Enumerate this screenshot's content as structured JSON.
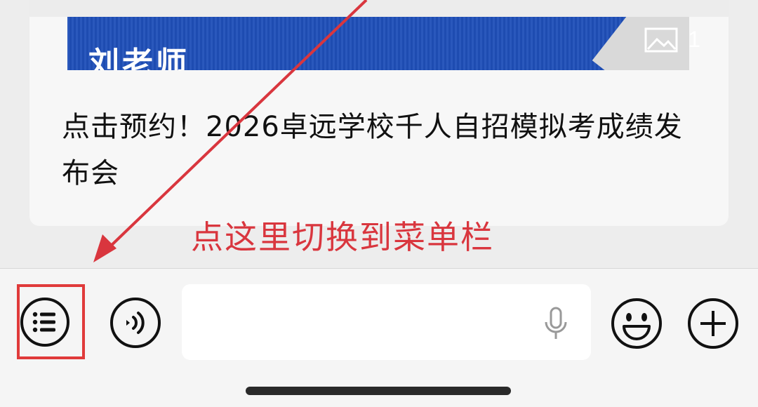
{
  "article_card": {
    "banner_title": "刘老师",
    "image_count": "1",
    "title": "点击预约！2026卓远学校千人自招模拟考成绩发布会"
  },
  "annotation": {
    "text": "点这里切换到菜单栏",
    "color": "#d9363e"
  },
  "toolbar": {
    "menu_icon": "menu-list-icon",
    "voice_icon": "voice-icon",
    "mic_icon": "microphone-icon",
    "emoji_icon": "emoji-icon",
    "add_icon": "plus-icon"
  }
}
